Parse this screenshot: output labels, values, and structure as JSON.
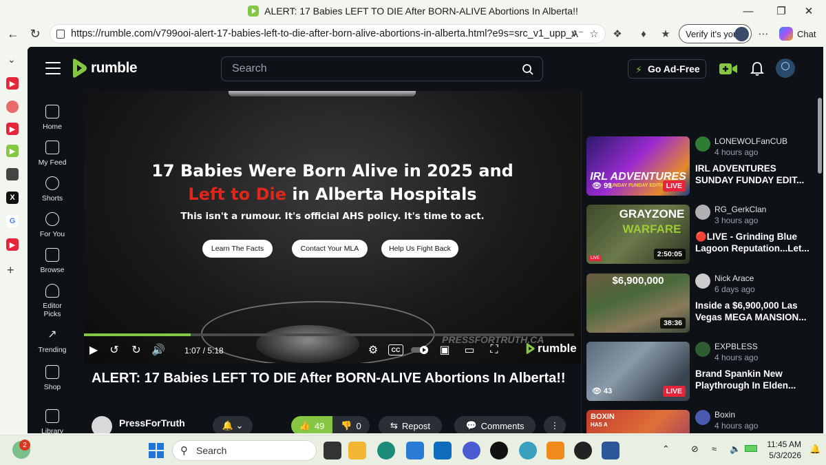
{
  "window": {
    "title": "ALERT: 17 Babies LEFT TO DIE After BORN-ALIVE Abortions In Alberta!!"
  },
  "browser": {
    "url": "https://rumble.com/v799ooi-alert-17-babies-left-to-die-after-born-alive-abortions-in-alberta.html?e9s=src_v1_upp_v",
    "verify_label": "Verify it's you",
    "chat_label": "Chat"
  },
  "header": {
    "logo_text": "rumble",
    "search_placeholder": "Search",
    "ad_free_label": "Go Ad-Free"
  },
  "nav": [
    {
      "label": "Home"
    },
    {
      "label": "My Feed"
    },
    {
      "label": "Shorts"
    },
    {
      "label": "For You"
    },
    {
      "label": "Browse"
    },
    {
      "label": "Editor Picks"
    },
    {
      "label": "Trending"
    },
    {
      "label": "Shop"
    },
    {
      "label": "Library"
    }
  ],
  "video": {
    "headline_1": "17 Babies Were Born Alive in 2025 and",
    "headline_2_red": "Left to Die",
    "headline_2_rest": " in Alberta Hospitals",
    "subline": "This isn't a rumour. It's official AHS policy. It's time to act.",
    "buttons": [
      "Learn The Facts",
      "Contact Your MLA",
      "Help Us Fight Back"
    ],
    "watermark": "PRESSFORTRUTH.CA",
    "progress_fraction": 0.218,
    "timecode": "1:07 / 5:18",
    "player_logo": "rumble",
    "cc_label": "CC"
  },
  "details": {
    "title": "ALERT: 17 Babies LEFT TO DIE After BORN-ALIVE Abortions In Alberta!!",
    "channel": "PressForTruth",
    "likes": "49",
    "dislikes": "0",
    "repost_label": "Repost",
    "comments_label": "Comments"
  },
  "related": [
    {
      "channel": "LONEWOLFanCUB",
      "time": "4 hours ago",
      "title_1": "IRL ADVENTURES",
      "title_2": "SUNDAY FUNDAY EDIT...",
      "badge": "LIVE",
      "views": "91",
      "thumb_text": "IRL ADVENTURES",
      "thumb_sub": "SUNDAY FUNDAY EDITION"
    },
    {
      "channel": "RG_GerkClan",
      "time": "3 hours ago",
      "title_1": "🔴LIVE - Grinding Blue",
      "title_2": "Lagoon Reputation...Let...",
      "badge": "2:50:05",
      "thumb_text": "GRAYZONE",
      "thumb_sub": "WARFARE",
      "thumb_live": "LIVE"
    },
    {
      "channel": "Nick Arace",
      "time": "6 days ago",
      "title_1": "Inside a $6,900,000 Las",
      "title_2": "Vegas MEGA MANSION...",
      "badge": "38:36",
      "thumb_text": "$6,900,000"
    },
    {
      "channel": "EXPBLESS",
      "time": "4 hours ago",
      "title_1": "Brand Spankin New",
      "title_2": "Playthrough In Elden...",
      "badge": "LIVE",
      "views": "43"
    },
    {
      "channel": "Boxin",
      "time": "4 hours ago",
      "title_1": "",
      "title_2": "",
      "thumb_text": "BOXIN",
      "thumb_sub": "HAS A"
    }
  ],
  "taskbar": {
    "search_label": "Search",
    "notification_count": "2",
    "time": "11:45 AM",
    "date": "5/3/2026"
  },
  "colors": {
    "accent": "#85c742",
    "live_red": "#e5253b",
    "bg": "#0e1116"
  }
}
